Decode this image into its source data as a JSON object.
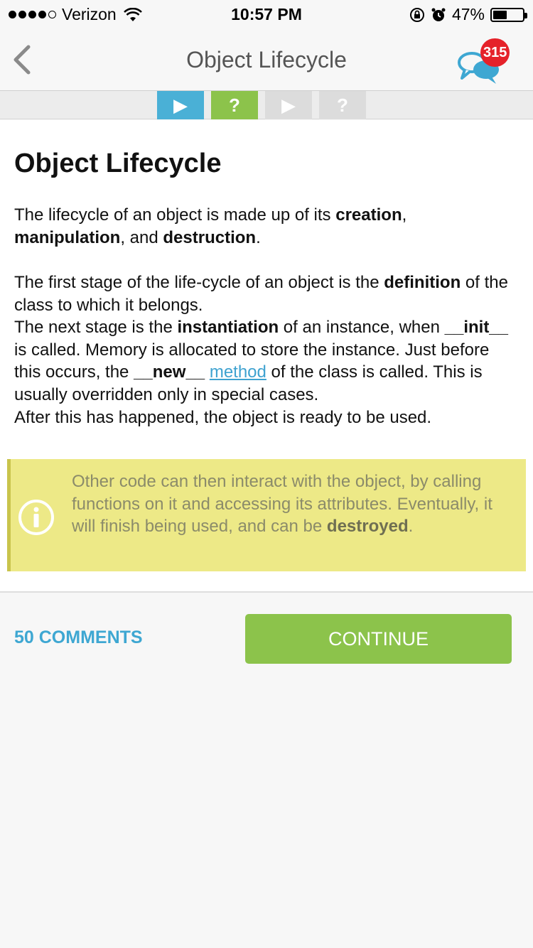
{
  "status_bar": {
    "carrier": "Verizon",
    "time": "10:57 PM",
    "battery": "47%",
    "battery_level": 0.47
  },
  "nav": {
    "back_icon": "chevron-left-icon",
    "title": "Object Lifecycle",
    "comments_icon": "chat-bubbles-icon",
    "badge_count": "315"
  },
  "progress": {
    "steps": [
      {
        "icon": "play-icon",
        "glyph": "▶",
        "state": "current"
      },
      {
        "icon": "question-icon",
        "glyph": "?",
        "state": "done"
      },
      {
        "icon": "play-icon",
        "glyph": "▶",
        "state": "pending"
      },
      {
        "icon": "question-icon",
        "glyph": "?",
        "state": "pending"
      }
    ]
  },
  "lesson": {
    "title": "Object Lifecycle",
    "p1": {
      "t1": "The lifecycle of an object is made up of its ",
      "b1": "creation",
      "t2": ", ",
      "b2": "manipulation",
      "t3": ", and ",
      "b3": "destruction",
      "t4": "."
    },
    "p2": {
      "t1": "The first stage of the life-cycle of an object is the ",
      "b1": "definition",
      "t2": " of the class to which it belongs.",
      "t3": "The next stage is the ",
      "b2": "instantiation",
      "t4": " of an instance, when ",
      "b3": "__init__",
      "t5": " is called. Memory is allocated to store the instance. Just before this occurs, the ",
      "b4": "__new__",
      "t6": " ",
      "link": "method",
      "t7": " of the class is called. This is usually overridden only in special cases.",
      "t8": "After this has happened, the object is ready to be used."
    },
    "info": {
      "icon": "info-icon",
      "t1": "Other code can then interact with the object, by calling functions on it and accessing its attributes. Eventually, it will finish being used, and can be ",
      "b1": "destroyed",
      "t2": "."
    }
  },
  "footer": {
    "comments_label": "50 COMMENTS",
    "continue_label": "CONTINUE"
  },
  "colors": {
    "accent_blue": "#4ab0d6",
    "accent_green": "#8cc34b",
    "badge_red": "#e5222a",
    "info_bg": "#ede987",
    "link": "#3ea2d0"
  }
}
